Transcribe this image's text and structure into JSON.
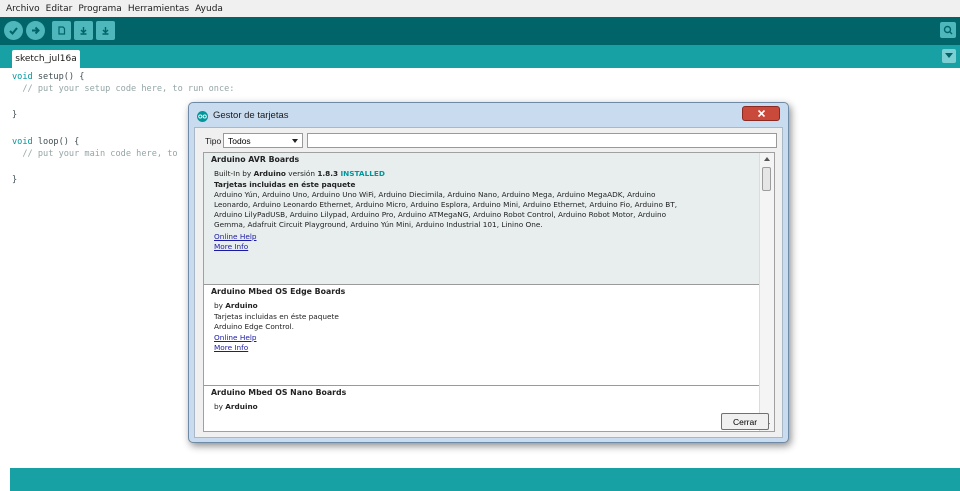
{
  "menu": [
    "Archivo",
    "Editar",
    "Programa",
    "Herramientas",
    "Ayuda"
  ],
  "toolbar_icons": [
    "verify-icon",
    "upload-icon",
    "new-icon",
    "open-icon",
    "save-icon",
    "serial-monitor-icon"
  ],
  "tab": {
    "label": "sketch_jul16a"
  },
  "code": {
    "line1_kw": "void",
    "line1_rest": " setup() {",
    "line2": "  // put your setup code here, to run once:",
    "line3": "}",
    "line4_kw": "void",
    "line4_rest": " loop() {",
    "line5": "  // put your main code here, to",
    "line6": "}"
  },
  "colors": {
    "toolbar": "#006468",
    "tabbar": "#17a1a5",
    "keyword": "#00979c",
    "link": "#1a1aa6"
  },
  "dialog": {
    "title": "Gestor de tarjetas",
    "filter_label": "Tipo",
    "filter_value": "Todos",
    "search_value": "",
    "close_label": "Cerrar",
    "boards": [
      {
        "name": "Arduino AVR Boards",
        "builtin_prefix": "Built-In by",
        "builtin_author": "Arduino",
        "version_prefix": "versión",
        "version": "1.8.3",
        "status": "INSTALLED",
        "included_label": "Tarjetas incluidas en éste paquete",
        "boards_line1": "Arduino Yún, Arduino Uno, Arduino Uno WiFi, Arduino Diecimila, Arduino Nano, Arduino Mega, Arduino MegaADK, Arduino",
        "boards_line2": "Leonardo, Arduino Leonardo Ethernet, Arduino Micro, Arduino Esplora, Arduino Mini, Arduino Ethernet, Arduino Fio, Arduino BT,",
        "boards_line3": "Arduino LilyPadUSB, Arduino Lilypad, Arduino Pro, Arduino ATMegaNG, Arduino Robot Control, Arduino Robot Motor, Arduino",
        "boards_line4": "Gemma, Adafruit Circuit Playground, Arduino Yún Mini, Arduino Industrial 101, Linino One.",
        "online_help": "Online Help",
        "more_info": "More Info"
      },
      {
        "name": "Arduino Mbed OS Edge Boards",
        "by_prefix": "by",
        "author": "Arduino",
        "included_label": "Tarjetas incluidas en éste paquete",
        "boards_line1": "Arduino Edge Control.",
        "online_help": "Online Help",
        "more_info": "More Info"
      },
      {
        "name": "Arduino Mbed OS Nano Boards",
        "by_prefix": "by",
        "author": "Arduino"
      }
    ]
  }
}
